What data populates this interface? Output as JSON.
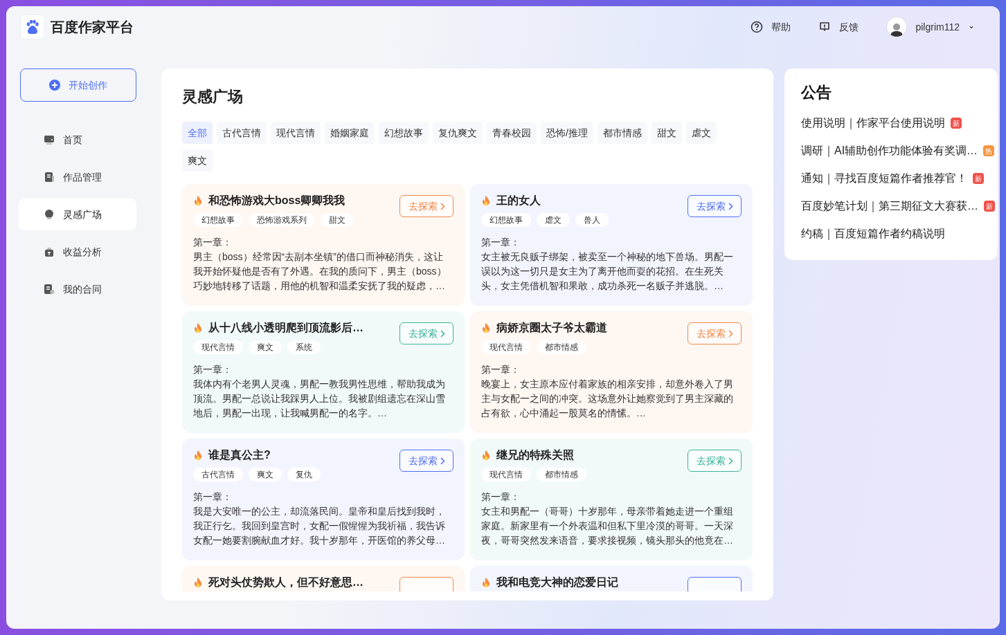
{
  "header": {
    "logo_text": "百度作家平台",
    "links": [
      {
        "kind": "help",
        "label": "帮助"
      },
      {
        "kind": "feedback",
        "label": "反馈"
      }
    ],
    "user": {
      "name": "pilgrim112",
      "caret": "⌄"
    }
  },
  "sidebar": {
    "create_button": "开始创作",
    "items": [
      {
        "kind": "home",
        "label": "首页",
        "selected": false
      },
      {
        "kind": "works",
        "label": "作品管理",
        "selected": false
      },
      {
        "kind": "inspire",
        "label": "灵感广场",
        "selected": true
      },
      {
        "kind": "income",
        "label": "收益分析",
        "selected": false
      },
      {
        "kind": "contract",
        "label": "我的合同",
        "selected": false
      }
    ]
  },
  "main": {
    "title": "灵感广场",
    "filters": [
      {
        "label": "全部",
        "selected": true
      },
      {
        "label": "古代言情",
        "selected": false
      },
      {
        "label": "现代言情",
        "selected": false
      },
      {
        "label": "婚姻家庭",
        "selected": false
      },
      {
        "label": "幻想故事",
        "selected": false
      },
      {
        "label": "复仇爽文",
        "selected": false
      },
      {
        "label": "青春校园",
        "selected": false
      },
      {
        "label": "恐怖/推理",
        "selected": false
      },
      {
        "label": "都市情感",
        "selected": false
      },
      {
        "label": "甜文",
        "selected": false
      },
      {
        "label": "虐文",
        "selected": false
      },
      {
        "label": "爽文",
        "selected": false
      }
    ],
    "cards": [
      {
        "title": "和恐怖游戏大boss卿卿我我",
        "color": "#f0874a",
        "button": "去探索",
        "tags": [
          "幻想故事",
          "恐怖游戏系列",
          "甜文"
        ],
        "chapter": "第一章：",
        "excerpt": "男主（boss）经常因“去副本坐镇”的借口而神秘消失，这让我开始怀疑他是否有了外遇。在我的质问下，男主（boss）巧妙地转移了话题，用他的机智和温柔安抚了我的疑虑，…"
      },
      {
        "title": "王的女人",
        "color": "#4e6ef2",
        "button": "去探索",
        "tags": [
          "幻想故事",
          "虐文",
          "兽人"
        ],
        "chapter": "第一章：",
        "excerpt": "女主被无良贩子绑架，被卖至一个神秘的地下兽场。男配一误以为这一切只是女主为了离开他而耍的花招。在生死关头，女主凭借机智和果敢，成功杀死一名贩子并逃脱。…"
      },
      {
        "title": "从十八线小透明爬到顶流影后…",
        "color": "#3bb39a",
        "button": "去探索",
        "tags": [
          "现代言情",
          "爽文",
          "系统"
        ],
        "chapter": "第一章：",
        "excerpt": "我体内有个老男人灵魂，男配一教我男性思维，帮助我成为顶流。男配一总说让我踩男人上位。我被剧组遗忘在深山雪地后，男配一出现，让我喊男配一的名字。…"
      },
      {
        "title": "病娇京圈太子爷太霸道",
        "color": "#f0874a",
        "button": "去探索",
        "tags": [
          "现代言情",
          "都市情感"
        ],
        "chapter": "第一章：",
        "excerpt": "晚宴上，女主原本应付着家族的相亲安排，却意外卷入了男主与女配一之间的冲突。这场意外让她察觉到了男主深藏的占有欲，心中涌起一股莫名的情愫。…"
      },
      {
        "title": "谁是真公主?",
        "color": "#4e6ef2",
        "button": "去探索",
        "tags": [
          "古代言情",
          "爽文",
          "复仇"
        ],
        "chapter": "第一章：",
        "excerpt": "我是大安唯一的公主，却流落民间。皇帝和皇后找到我时，我正行乞。我回到皇宫时，女配一假惺惺为我祈福，我告诉女配一她要割腕献血才好。我十岁那年，开医馆的养父母…"
      },
      {
        "title": "继兄的特殊关照",
        "color": "#3bb39a",
        "button": "去探索",
        "tags": [
          "现代言情",
          "都市情感"
        ],
        "chapter": "第一章：",
        "excerpt": "女主和男配一（哥哥）十岁那年，母亲带着她走进一个重组家庭。新家里有一个外表温和但私下里冷漠的哥哥。一天深夜，哥哥突然发来语音，要求接视频，镜头那头的他竟在…"
      },
      {
        "title": "死对头仗势欺人，但不好意思…",
        "color": "#f0874a"
      },
      {
        "title": "我和电竞大神的恋爱日记",
        "color": "#4e6ef2"
      }
    ]
  },
  "notices": {
    "title": "公告",
    "items": [
      {
        "text": "使用说明｜作家平台使用说明",
        "badge": "新",
        "color": "#f0504a"
      },
      {
        "text": "调研｜AI辅助创作功能体验有奖调…",
        "badge": "热",
        "color": "#f5953f"
      },
      {
        "text": "通知｜寻找百度短篇作者推荐官！",
        "badge": "新",
        "color": "#f0504a"
      },
      {
        "text": "百度妙笔计划｜第三期征文大赛获…",
        "badge": "新",
        "color": "#f0504a"
      },
      {
        "text": "约稿｜百度短篇作者约稿说明"
      }
    ]
  }
}
